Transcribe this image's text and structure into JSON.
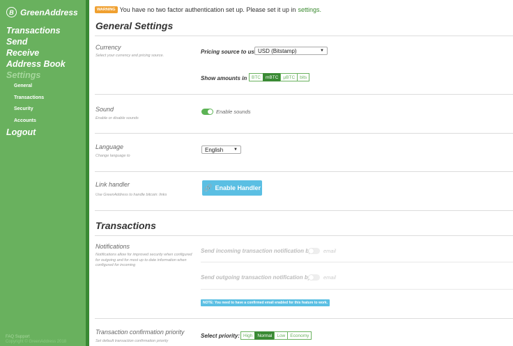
{
  "sidebar": {
    "logo_mark": "B",
    "logo_text": "GreenAddress",
    "nav": [
      {
        "label": "Transactions"
      },
      {
        "label": "Send"
      },
      {
        "label": "Receive"
      },
      {
        "label": "Address Book"
      },
      {
        "label": "Settings"
      }
    ],
    "sub": [
      {
        "label": "General"
      },
      {
        "label": "Transactions"
      },
      {
        "label": "Security"
      },
      {
        "label": "Accounts"
      }
    ],
    "logout": "Logout",
    "footer": {
      "faq": "FAQ",
      "support": "Support",
      "copyright": "Copyright © GreenAddress 2018"
    }
  },
  "warning": {
    "badge": "WARNING",
    "text": "You have no two factor authentication set up. Please set it up in",
    "link": "settings."
  },
  "general": {
    "title": "General Settings",
    "currency": {
      "title": "Currency",
      "desc": "Select your currency and pricing source.",
      "pricing_label": "Pricing source to use",
      "pricing_value": "USD (Bitstamp)",
      "amounts_label": "Show amounts in",
      "units": [
        "BTC",
        "mBTC",
        "µBTC",
        "bits"
      ],
      "active_unit": "mBTC"
    },
    "sound": {
      "title": "Sound",
      "desc": "Enable or disable sounds",
      "toggle_label": "Enable sounds"
    },
    "language": {
      "title": "Language",
      "desc": "Change language to",
      "value": "English"
    },
    "link_handler": {
      "title": "Link handler",
      "desc": "Use GreenAddress to handle bitcoin: links",
      "button": "Enable Handler"
    }
  },
  "transactions": {
    "title": "Transactions",
    "notifications": {
      "title": "Notifications",
      "desc": "Notifications allow for improved security when configured for outgoing and for most up to date information when configured for incoming",
      "incoming_label": "Send incoming transaction notification by",
      "outgoing_label": "Send outgoing transaction notification by",
      "channel": "email",
      "note": "NOTE: You need to have a confirmed email enabled for this feature to work."
    },
    "priority": {
      "title": "Transaction confirmation priority",
      "desc": "Set default transaction confirmation priority",
      "label": "Select priority:",
      "options": [
        "High",
        "Normal",
        "Low",
        "Economy"
      ],
      "active": "Normal"
    }
  }
}
